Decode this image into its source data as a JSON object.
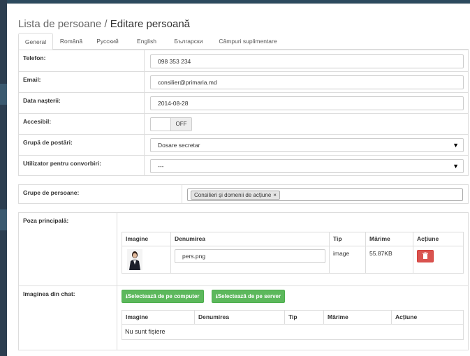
{
  "breadcrumb": {
    "parent": "Lista de persoane",
    "separator": " / ",
    "current": "Editare persoană"
  },
  "tabs": [
    {
      "label": "General",
      "active": true
    },
    {
      "label": "Română"
    },
    {
      "label": "Русский"
    },
    {
      "label": "English"
    },
    {
      "label": "Български"
    },
    {
      "label": "Câmpuri suplimentare"
    }
  ],
  "form": {
    "phone": {
      "label": "Telefon:",
      "value": "098 353 234"
    },
    "email": {
      "label": "Email:",
      "value": "consilier@primaria.md"
    },
    "birthdate": {
      "label": "Data nașterii:",
      "value": "2014-08-28"
    },
    "accessible": {
      "label": "Accesibil:",
      "state": "OFF"
    },
    "post_group": {
      "label": "Grupă de postări:",
      "value": "Dosare secretar"
    },
    "chat_user": {
      "label": "Utilizator pentru convorbiri:",
      "value": "---"
    },
    "person_groups": {
      "label": "Grupe de persoane:",
      "tag": "Consilieri și domenii de acțiune",
      "tag_remove": "×"
    }
  },
  "main_image": {
    "label": "Poza principală:",
    "columns": [
      "Imagine",
      "Denumirea",
      "Tip",
      "Mărime",
      "Acțiune"
    ],
    "file": {
      "name": "pers.png",
      "type": "image",
      "size": "55.87KB"
    }
  },
  "chat_image": {
    "label": "Imaginea din chat:",
    "btn_computer": "Selectează de pe computer",
    "btn_server": "Selectează de pe server",
    "columns": [
      "Imagine",
      "Denumirea",
      "Tip",
      "Mărime",
      "Acțiune"
    ],
    "empty": "Nu sunt fișiere"
  },
  "colors": {
    "success": "#5cb85c",
    "danger": "#d9534f",
    "sidebar": "#2c3e50"
  }
}
